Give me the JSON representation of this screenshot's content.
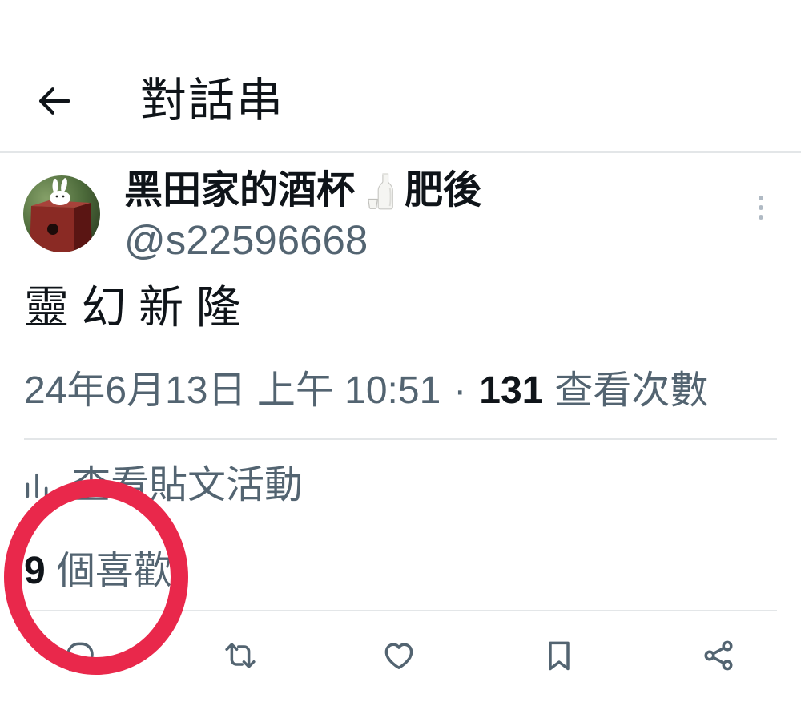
{
  "header": {
    "back_icon": "back-arrow-icon",
    "title": "對話串"
  },
  "post": {
    "author": {
      "avatar": "avatar-image",
      "name_part1": "黑田家的酒杯",
      "name_emoji_icon": "sake-bottle-icon",
      "name_part2": "肥後",
      "handle": "@s22596668"
    },
    "more_icon": "more-vertical-icon",
    "text": "靈 幻 新 隆",
    "meta": {
      "timestamp": "24年6月13日 上午 10:51",
      "separator": "·",
      "views_count": "131",
      "views_label": "查看次數"
    },
    "activity": {
      "icon": "analytics-icon",
      "label": "查看貼文活動"
    },
    "likes": {
      "count": "9",
      "label": "個喜歡"
    }
  },
  "actions": [
    {
      "icon": "reply-icon"
    },
    {
      "icon": "retweet-icon"
    },
    {
      "icon": "like-icon"
    },
    {
      "icon": "bookmark-icon"
    },
    {
      "icon": "share-icon"
    }
  ],
  "colors": {
    "text_primary": "#0f1419",
    "text_secondary": "#536471",
    "divider": "#e3e6e8",
    "background": "#ffffff",
    "annotation": "#e9284b"
  }
}
